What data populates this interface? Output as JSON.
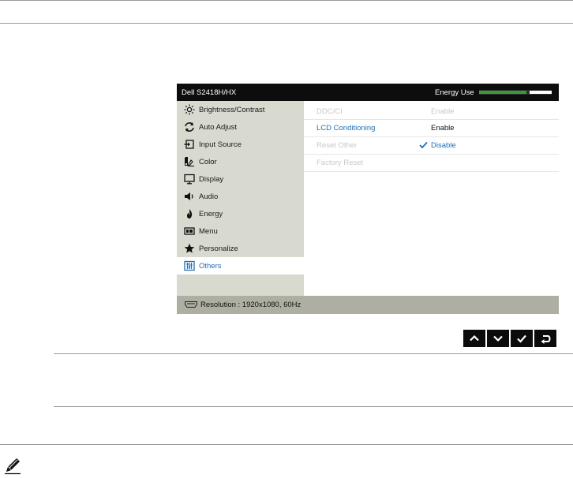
{
  "osd": {
    "model": "Dell S2418H/HX",
    "energy_label": "Energy Use",
    "energy_level": 0.7,
    "menu": [
      {
        "label": "Brightness/Contrast",
        "icon": "brightness-icon",
        "selected": false
      },
      {
        "label": "Auto Adjust",
        "icon": "auto-adjust-icon",
        "selected": false
      },
      {
        "label": "Input Source",
        "icon": "input-source-icon",
        "selected": false
      },
      {
        "label": "Color",
        "icon": "color-icon",
        "selected": false
      },
      {
        "label": "Display",
        "icon": "display-icon",
        "selected": false
      },
      {
        "label": "Audio",
        "icon": "audio-icon",
        "selected": false
      },
      {
        "label": "Energy",
        "icon": "energy-icon",
        "selected": false
      },
      {
        "label": "Menu",
        "icon": "menu-icon",
        "selected": false
      },
      {
        "label": "Personalize",
        "icon": "star-icon",
        "selected": false
      },
      {
        "label": "Others",
        "icon": "others-icon",
        "selected": true
      }
    ],
    "options": [
      {
        "name": "DDC/CI",
        "value": "Enable",
        "state": "dim"
      },
      {
        "name": "LCD Conditioning",
        "value": "Enable",
        "state": "active"
      },
      {
        "name": "Reset Other",
        "value": "Disable",
        "state": "dim-checked"
      },
      {
        "name": "Factory Reset",
        "value": "",
        "state": "dim"
      }
    ],
    "footer": "Resolution : 1920x1080, 60Hz"
  },
  "nav_buttons": [
    "up-arrow-icon",
    "down-arrow-icon",
    "checkmark-icon",
    "back-icon"
  ],
  "colors": {
    "accent": "#1f6fb8",
    "energy_bar": "#3a9a3a",
    "menu_bg": "#d8d9cf",
    "footer_bg": "#aeaea2"
  }
}
